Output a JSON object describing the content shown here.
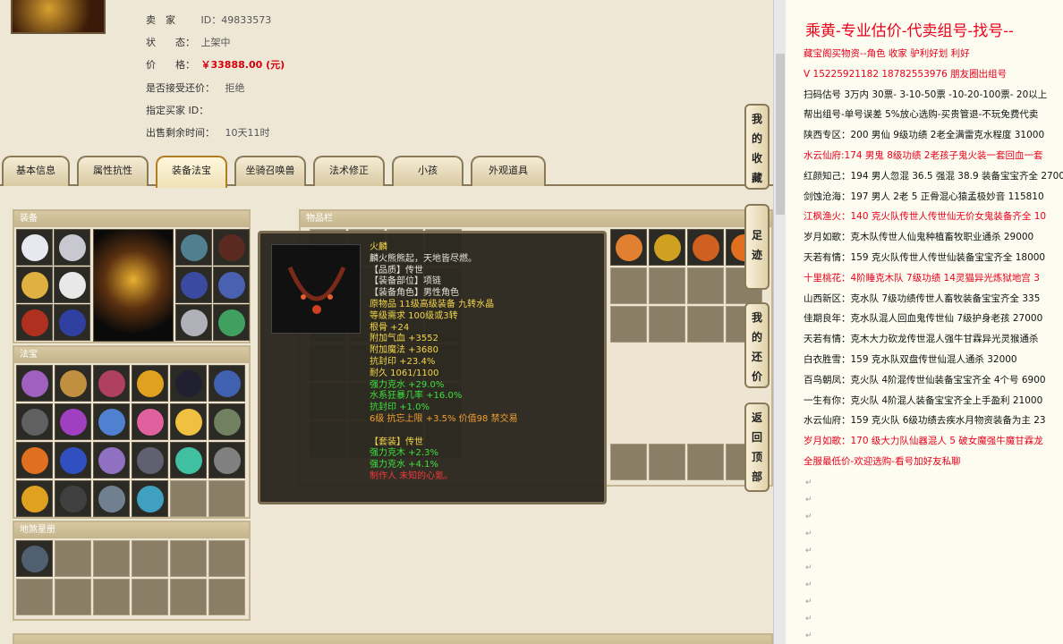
{
  "seller": {
    "label": "卖　家",
    "value": "ID：49833573"
  },
  "status": {
    "label": "状　　态：",
    "value": "上架中"
  },
  "price": {
    "label": "价　　格：",
    "value": "￥33888.00 (元)"
  },
  "counter": {
    "label": "是否接受还价：",
    "value": "拒绝"
  },
  "buyer": {
    "label": "指定买家 ID：",
    "value": ""
  },
  "remain": {
    "label": "出售剩余时间：",
    "value": "10天11时"
  },
  "tabs": [
    "基本信息",
    "属性抗性",
    "装备法宝",
    "坐骑召唤兽",
    "法术修正",
    "小孩",
    "外观道具"
  ],
  "panels": {
    "equip": "装备",
    "fabao": "法宝",
    "star": "地煞星册",
    "bag": "物品栏"
  },
  "tooltip": {
    "name": "火麟",
    "desc": "麟火熊熊起，天地皆尽燃。",
    "lines": [
      {
        "t": "【品质】传世",
        "c": "white"
      },
      {
        "t": "【装备部位】项链",
        "c": "white"
      },
      {
        "t": "【装备角色】男性角色",
        "c": "white"
      },
      {
        "t": "原物品 11级高级装备 九转水晶",
        "c": "yellow"
      },
      {
        "t": "等级需求 100级或3转",
        "c": "yellow"
      },
      {
        "t": "根骨 +24",
        "c": "yellow"
      },
      {
        "t": "附加气血 +3552",
        "c": "yellow"
      },
      {
        "t": "附加魔法 +3680",
        "c": "yellow"
      },
      {
        "t": "抗封印 +23.4%",
        "c": "yellow"
      },
      {
        "t": "耐久 1061/1100",
        "c": "yellow"
      },
      {
        "t": "强力克水 +29.0%",
        "c": "green"
      },
      {
        "t": "水系狂暴几率 +16.0%",
        "c": "green"
      },
      {
        "t": "抗封印 +1.0%",
        "c": "green"
      },
      {
        "t": "6级 抗忘上限 +3.5% 价值98 禁交易",
        "c": "orange"
      },
      {
        "t": "",
        "c": "white"
      },
      {
        "t": "【套装】传世",
        "c": "yellow"
      },
      {
        "t": "强力克木 +2.3%",
        "c": "green"
      },
      {
        "t": "强力克水 +4.1%",
        "c": "green"
      },
      {
        "t": "制作人 未知的心氪。",
        "c": "red"
      }
    ]
  },
  "side_buttons": [
    "我的收藏",
    "足迹",
    "我的还价",
    "返回顶部"
  ],
  "right": {
    "title": "乘黄-专业估价-代卖组号-找号--",
    "lines": [
      {
        "t": "藏宝阁买物资--角色 收家 驴利好划 利好",
        "c": "red"
      },
      {
        "t": "V 15225921182   18782553976 朋友圈出组号",
        "c": "red"
      },
      {
        "t": "扫码估号 3万内 30票- 3-10-50票  -10-20-100票- 20以上",
        "c": "black"
      },
      {
        "t": "帮出组号-单号误差 5%放心选购-买贵管退-不玩免费代卖",
        "c": "black"
      },
      {
        "t": "陕西专区：200 男仙 9级功绩 2老全满雷克水程度 31000",
        "c": "black"
      },
      {
        "t": "水云仙府:174 男鬼 8级功绩 2老孩子鬼火装一套回血一套",
        "c": "red"
      },
      {
        "t": "红颜知己：194 男人忽混 36.5 强混 38.9 装备宝宝齐全 2700",
        "c": "black"
      },
      {
        "t": "剑蚀沧海：197 男人 2老 5 正骨混心猿孟极妙音 115810",
        "c": "black"
      },
      {
        "t": "江枫渔火：140 克火队传世人传世仙无价女鬼装备齐全 10",
        "c": "red"
      },
      {
        "t": "岁月如歌：克木队传世人仙鬼种植畜牧职业通杀 29000",
        "c": "black"
      },
      {
        "t": "天若有情：159 克火队传世人传世仙装备宝宝齐全 18000",
        "c": "black"
      },
      {
        "t": "十里桃花：4阶睡克木队 7级功绩 14灵猫异光炼狱地宫 3",
        "c": "red"
      },
      {
        "t": "山西新区：克水队 7级功绩传世人畜牧装备宝宝齐全 335",
        "c": "black"
      },
      {
        "t": "佳期良年：克水队混人回血鬼传世仙 7级护身老孩 27000",
        "c": "black"
      },
      {
        "t": "天若有情：克木大力砍龙传世混人强牛甘霖异光灵猴通杀",
        "c": "black"
      },
      {
        "t": "白衣胜雪：159 克水队双盘传世仙混人通杀 32000",
        "c": "black"
      },
      {
        "t": "百鸟朝凤：克火队 4阶混传世仙装备宝宝齐全 4个号 6900",
        "c": "black"
      },
      {
        "t": "一生有你：克火队 4阶混人装备宝宝齐全上手盈利 21000",
        "c": "black"
      },
      {
        "t": "水云仙府：159 克火队 6级功绩去疾水月物资装备为主 23",
        "c": "black"
      },
      {
        "t": "岁月如歌：170 级大力队仙器混人 5 破女魔强牛魔甘霖龙",
        "c": "red"
      },
      {
        "t": "全服最低价-欢迎选购-看号加好友私聊",
        "c": "red"
      }
    ]
  },
  "colors": {
    "accent": "#d4000c",
    "panel": "#c4b693"
  }
}
